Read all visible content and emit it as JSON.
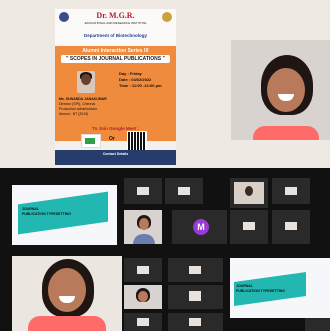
{
  "poster": {
    "college": "Dr. M.G.R.",
    "college_sub": "EDUCATIONAL AND RESEARCH INSTITUTE",
    "department": "Department of Biotechnology",
    "series": "Alumni Interaction Series IX",
    "topic": "\" SCOPES IN JOURNAL PUBLICATIONS \"",
    "speaker_name": "Ms. SUNANDA JANAKUMAR",
    "speaker_role": "Director (SPI), Chennai",
    "speaker_role2": "Production administrator",
    "speaker_batch": "Alumni - BT (2015)",
    "day": "Day : Friday",
    "date": "Date : 04/02/2022",
    "time": "Time : 11:00 -12:00 pm",
    "join_label": "To Join Google Meet :",
    "or": "Or",
    "contact": "Contact Details"
  },
  "grid": {
    "slide_title_line1": "JOURNAL",
    "slide_title_line2": "PUBLICATION TYPESETTING",
    "avatar_letter": "M"
  }
}
